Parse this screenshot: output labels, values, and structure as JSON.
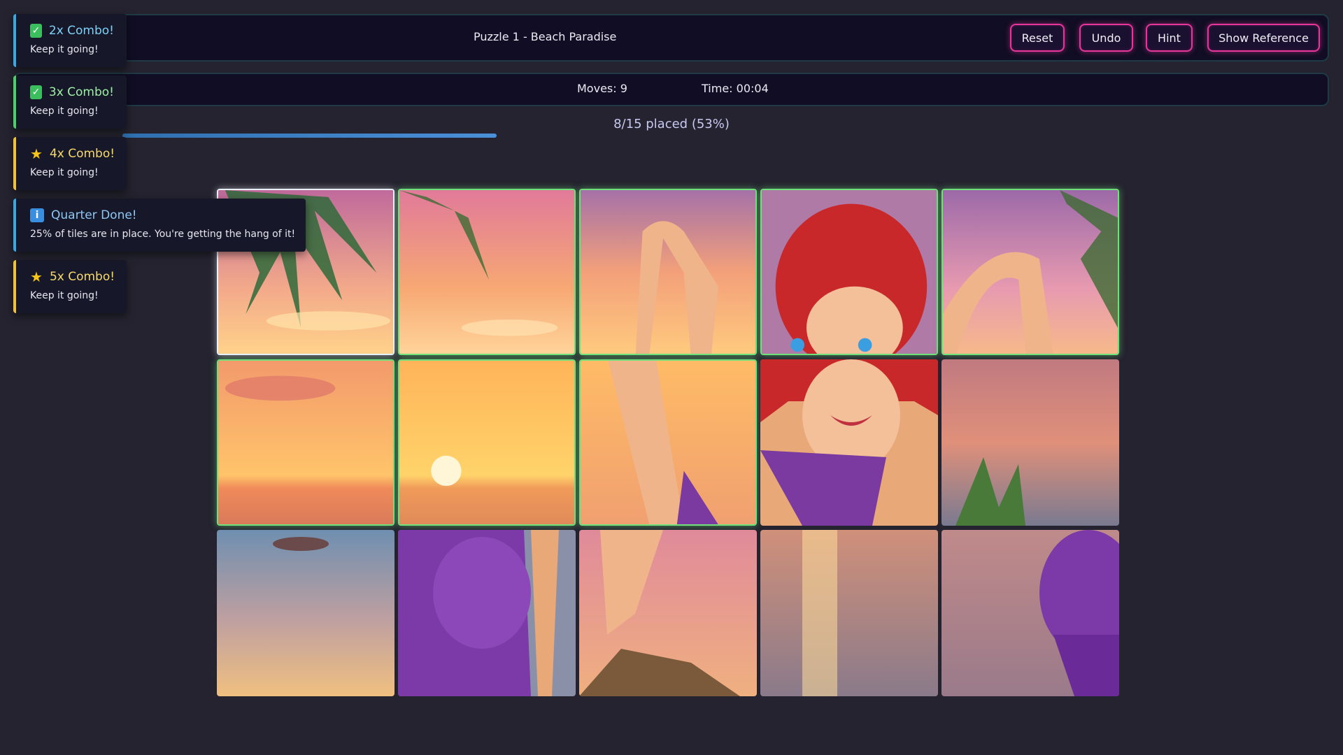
{
  "header": {
    "title": "Puzzle 1 - Beach Paradise",
    "buttons": {
      "reset": "Reset",
      "undo": "Undo",
      "hint": "Hint",
      "reference": "Show Reference"
    }
  },
  "stats": {
    "moves": "Moves: 9",
    "time": "Time: 00:04"
  },
  "progress": {
    "label": "8/15 placed (53%)",
    "fraction": 0.53
  },
  "toasts": [
    {
      "title": "2x Combo!",
      "message": "Keep it going!",
      "icon": "check-icon",
      "color": "#3aa7e0",
      "title_color": "#7fd0f7"
    },
    {
      "title": "3x Combo!",
      "message": "Keep it going!",
      "icon": "check-icon",
      "color": "#4ccf6b",
      "title_color": "#9ff0a4"
    },
    {
      "title": "4x Combo!",
      "message": "Keep it going!",
      "icon": "star-icon",
      "color": "#f2c232",
      "title_color": "#f7d96b"
    },
    {
      "title": "Quarter Done!",
      "message": "25% of tiles are in place. You're getting the hang of it!",
      "icon": "info-icon",
      "color": "#3aa7e0",
      "title_color": "#8fc7f2"
    },
    {
      "title": "5x Combo!",
      "message": "Keep it going!",
      "icon": "star-icon",
      "color": "#f2c232",
      "title_color": "#f7d96b"
    }
  ],
  "colors": {
    "accent": "#e6369a",
    "placed": "#6fe07a",
    "progress": "#4a90d8"
  }
}
